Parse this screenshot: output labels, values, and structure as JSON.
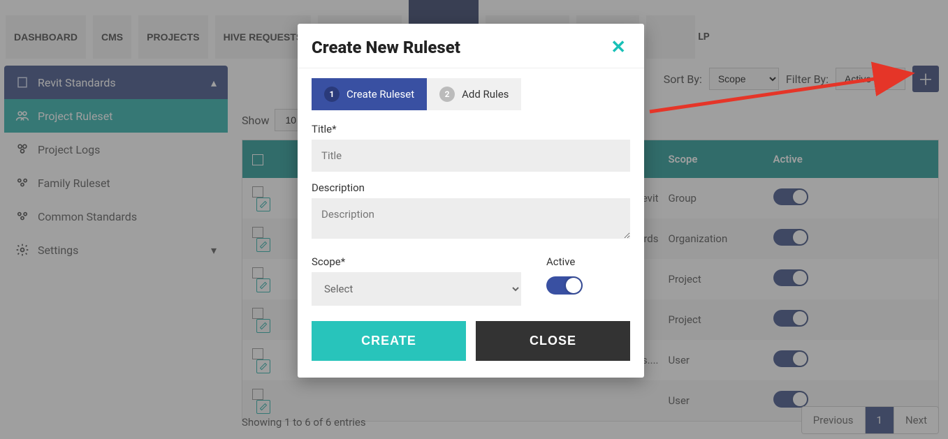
{
  "topnav": {
    "items": [
      {
        "label": "DASHBOARD"
      },
      {
        "label": "CMS"
      },
      {
        "label": "PROJECTS"
      },
      {
        "label": "HIVE REQUESTS"
      },
      {
        "label": ""
      },
      {
        "label": ""
      },
      {
        "label": ""
      },
      {
        "label": ""
      },
      {
        "label": ""
      }
    ],
    "help_fragment": "LP"
  },
  "sidebar": {
    "group": {
      "label": "Revit Standards"
    },
    "items": [
      {
        "label": "Project Ruleset"
      },
      {
        "label": "Project Logs"
      },
      {
        "label": "Family Ruleset"
      },
      {
        "label": "Common Standards"
      },
      {
        "label": "Settings"
      }
    ]
  },
  "filters": {
    "sort_label": "Sort By:",
    "sort_value": "Scope",
    "filter_label": "Filter By:",
    "filter_value": "Active"
  },
  "show": {
    "label": "Show",
    "value": "10"
  },
  "table": {
    "headers": {
      "scope": "Scope",
      "active": "Active"
    },
    "rows": [
      {
        "desc_fragment": "using Revit",
        "scope": "Group"
      },
      {
        "desc_fragment": "ion Standards",
        "scope": "Organization"
      },
      {
        "desc_fragment": "",
        "scope": "Project"
      },
      {
        "desc_fragment": "",
        "scope": "Project"
      },
      {
        "desc_fragment": "ings....",
        "scope": "User"
      },
      {
        "desc_fragment": "",
        "scope": "User"
      }
    ]
  },
  "entries_text": "Showing 1 to 6 of 6 entries",
  "pagination": {
    "prev": "Previous",
    "page": "1",
    "next": "Next"
  },
  "modal": {
    "title": "Create New Ruleset",
    "step1": "Create Ruleset",
    "step2": "Add Rules",
    "step1_num": "1",
    "step2_num": "2",
    "title_label": "Title*",
    "title_placeholder": "Title",
    "desc_label": "Description",
    "desc_placeholder": "Description",
    "scope_label": "Scope*",
    "scope_value": "Select",
    "active_label": "Active",
    "create_btn": "CREATE",
    "close_btn": "CLOSE"
  }
}
